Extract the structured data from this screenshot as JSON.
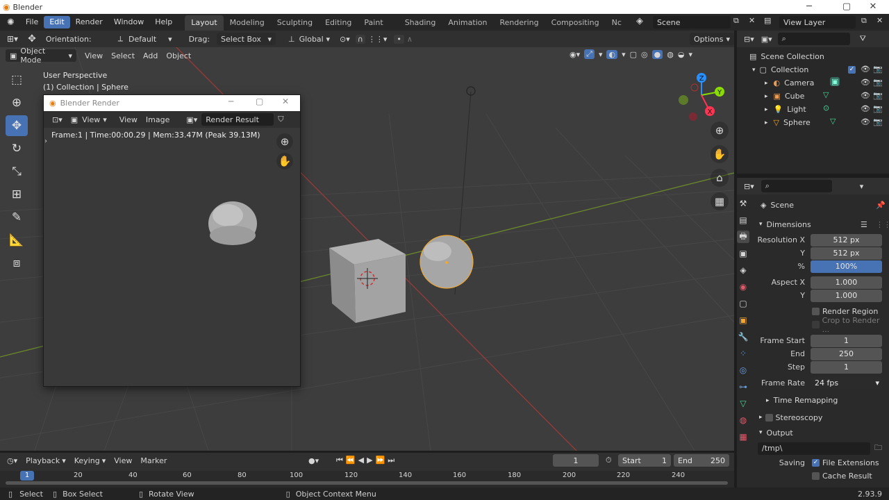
{
  "app": {
    "title": "Blender"
  },
  "menu": {
    "file": "File",
    "edit": "Edit",
    "render": "Render",
    "window": "Window",
    "help": "Help"
  },
  "workspaces": [
    "Layout",
    "Modeling",
    "Sculpting",
    "UV Editing",
    "Texture Paint",
    "Shading",
    "Animation",
    "Rendering",
    "Compositing",
    "Geometry Nc"
  ],
  "scene": {
    "name": "Scene"
  },
  "view_layer": {
    "name": "View Layer"
  },
  "tool_header": {
    "orientation_label": "Orientation:",
    "orientation_value": "Default",
    "drag_label": "Drag:",
    "drag_value": "Select Box",
    "transform_space": "Global",
    "options": "Options"
  },
  "viewport_header": {
    "mode": "Object Mode",
    "view": "View",
    "select": "Select",
    "add": "Add",
    "object": "Object"
  },
  "viewport_overlay": {
    "line1": "User Perspective",
    "line2": "(1) Collection | Sphere"
  },
  "gizmo": {
    "z": "Z",
    "y": "Y",
    "x": "X"
  },
  "render_window": {
    "title": "Blender Render",
    "view_menu": "View",
    "view_menu2": "View",
    "image_menu": "Image",
    "slot": "Render Result",
    "info": "Frame:1 | Time:00:00.29 | Mem:33.47M (Peak 39.13M)"
  },
  "outliner": {
    "root": "Scene Collection",
    "collection": "Collection",
    "items": [
      "Camera",
      "Cube",
      "Light",
      "Sphere"
    ]
  },
  "properties": {
    "scene": "Scene",
    "dimensions": "Dimensions",
    "res_x_label": "Resolution X",
    "res_x": "512 px",
    "res_y_label": "Y",
    "res_y": "512 px",
    "res_pct_label": "%",
    "res_pct": "100%",
    "res_pct_fill": 1.0,
    "aspect_x_label": "Aspect X",
    "aspect_x": "1.000",
    "aspect_y_label": "Y",
    "aspect_y": "1.000",
    "render_region": "Render Region",
    "crop_to_render": "Crop to Render ...",
    "frame_start_label": "Frame Start",
    "frame_start": "1",
    "frame_end_label": "End",
    "frame_end": "250",
    "frame_step_label": "Step",
    "frame_step": "1",
    "frame_rate_label": "Frame Rate",
    "frame_rate": "24 fps",
    "time_remapping": "Time Remapping",
    "stereoscopy": "Stereoscopy",
    "output": "Output",
    "output_path": "/tmp\\",
    "saving_label": "Saving",
    "file_extensions": "File Extensions",
    "cache_result": "Cache Result"
  },
  "timeline": {
    "playback": "Playback",
    "keying": "Keying",
    "view": "View",
    "marker": "Marker",
    "current_frame": "1",
    "start_label": "Start",
    "start": "1",
    "end_label": "End",
    "end": "250",
    "ruler": [
      "1",
      "20",
      "40",
      "60",
      "80",
      "100",
      "120",
      "140",
      "160",
      "180",
      "200",
      "220",
      "240"
    ]
  },
  "status": {
    "select": "Select",
    "box_select": "Box Select",
    "rotate_view": "Rotate View",
    "context_menu": "Object Context Menu",
    "version": "2.93.9"
  },
  "colors": {
    "accent": "#4772b3",
    "x_axis": "#ff3352",
    "y_axis": "#8bdc00",
    "z_axis": "#2890ff",
    "active_object": "#f4a72c"
  }
}
